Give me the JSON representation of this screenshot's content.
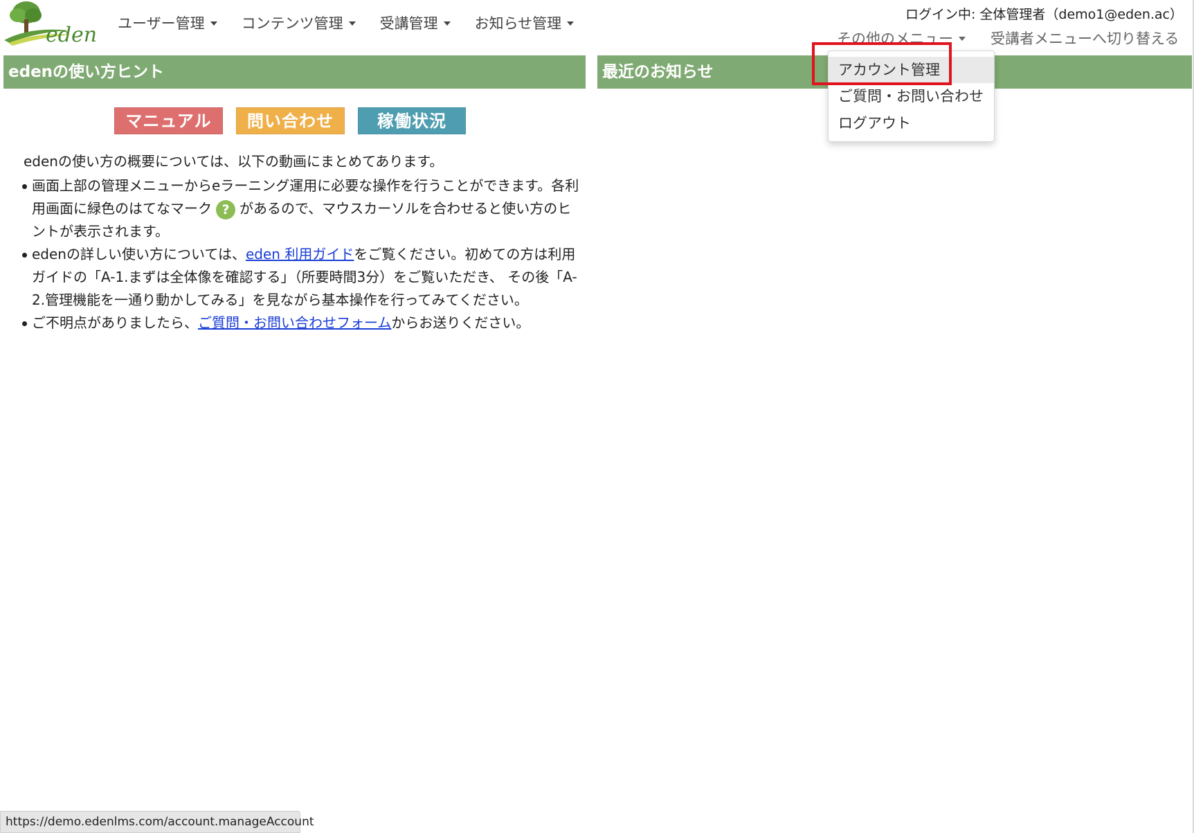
{
  "logo": {
    "text": "eden"
  },
  "nav": {
    "items": [
      {
        "label": "ユーザー管理"
      },
      {
        "label": "コンテンツ管理"
      },
      {
        "label": "受講管理"
      },
      {
        "label": "お知らせ管理"
      }
    ]
  },
  "header": {
    "login_status": "ログイン中: 全体管理者（demo1@eden.ac）",
    "other_menu_label": "その他のメニュー",
    "switch_label": "受講者メニューへ切り替える"
  },
  "dropdown": {
    "items": [
      {
        "label": "アカウント管理"
      },
      {
        "label": "ご質問・お問い合わせ"
      },
      {
        "label": "ログアウト"
      }
    ]
  },
  "hints": {
    "title": "edenの使い方ヒント",
    "buttons": {
      "manual": "マニュアル",
      "contact": "問い合わせ",
      "status": "稼働状況"
    },
    "intro": "edenの使い方の概要については、以下の動画にまとめてあります。",
    "item1_before": "画面上部の管理メニューからeラーニング運用に必要な操作を行うことができます。各利用画面に緑色のはてなマーク",
    "item1_icon": "?",
    "item1_after": "があるので、マウスカーソルを合わせると使い方のヒントが表示されます。",
    "item2_before": "edenの詳しい使い方については、",
    "item2_link": "eden 利用ガイド",
    "item2_after": "をご覧ください。初めての方は利用ガイドの「A-1.まずは全体像を確認する」（所要時間3分）をご覧いただき、 その後「A-2.管理機能を一通り動かしてみる」を見ながら基本操作を行ってみてください。",
    "item3_before": "ご不明点がありましたら、",
    "item3_link": "ご質問・お問い合わせフォーム",
    "item3_after": "からお送りください。"
  },
  "news": {
    "title": "最近のお知らせ"
  },
  "status_bar": {
    "url": "https://demo.edenlms.com/account.manageAccount"
  },
  "colors": {
    "panel_header": "#80aa73",
    "highlight": "#e0141e",
    "link": "#1a3dd6"
  }
}
